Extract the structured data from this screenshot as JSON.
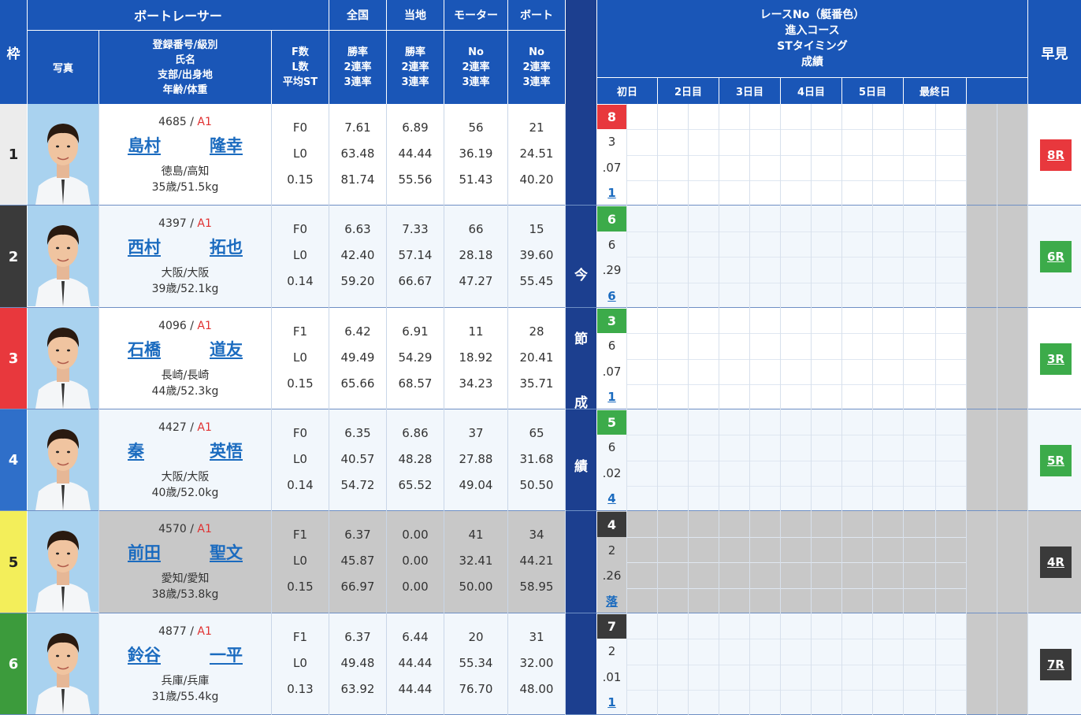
{
  "header": {
    "boatracer": "ボートレーサー",
    "zenkoku": "全国",
    "touchi": "当地",
    "motor": "モーター",
    "boat": "ボート",
    "waku": "枠",
    "photo": "写真",
    "profile": [
      "登録番号/級別",
      "氏名",
      "支部/出身地",
      "年齢/体重"
    ],
    "fl": [
      "F数",
      "L数",
      "平均ST"
    ],
    "zenkoku_sub": [
      "勝率",
      "2連率",
      "3連率"
    ],
    "touchi_sub": [
      "勝率",
      "2連率",
      "3連率"
    ],
    "motor_sub": [
      "No",
      "2連率",
      "3連率"
    ],
    "boat_sub": [
      "No",
      "2連率",
      "3連率"
    ],
    "konsetsu": [
      "今",
      "節",
      "成",
      "績"
    ],
    "race_info": [
      "レースNo（艇番色）",
      "進入コース",
      "STタイミング",
      "成績"
    ],
    "days": [
      "初日",
      "2日目",
      "3日目",
      "4日目",
      "5日目",
      "最終日"
    ],
    "hayami": "早見"
  },
  "colors": {
    "header_blue": "#1a56b7",
    "header_dark": "#1c3f8f",
    "link_blue": "#1b6bbf",
    "class_red": "#e03030",
    "lane1": "#ececec",
    "lane2": "#3a3a3a",
    "lane3": "#e8383d",
    "lane4": "#2f6fc9",
    "lane5": "#f3ee5a",
    "lane6": "#3c9b3c"
  },
  "racers": [
    {
      "lane": "1",
      "reg": "4685 /",
      "cls": "A1",
      "sei": "島村",
      "mei": "隆幸",
      "branch": "徳島/高知",
      "age_weight": "35歳/51.5kg",
      "f": "F0",
      "l": "L0",
      "st": "0.15",
      "z1": "7.61",
      "z2": "63.48",
      "z3": "81.74",
      "t1": "6.89",
      "t2": "44.44",
      "t3": "55.56",
      "m1": "56",
      "m2": "36.19",
      "m3": "51.43",
      "b1": "21",
      "b2": "24.51",
      "b3": "40.20",
      "race_boat": "8",
      "course": "3",
      "timing": ".07",
      "result": "1",
      "hayami": "8R",
      "boat_color": "#e8383d",
      "badge_color": "#e8383d",
      "shaded": false
    },
    {
      "lane": "2",
      "reg": "4397 /",
      "cls": "A1",
      "sei": "西村",
      "mei": "拓也",
      "branch": "大阪/大阪",
      "age_weight": "39歳/52.1kg",
      "f": "F0",
      "l": "L0",
      "st": "0.14",
      "z1": "6.63",
      "z2": "42.40",
      "z3": "59.20",
      "t1": "7.33",
      "t2": "57.14",
      "t3": "66.67",
      "m1": "66",
      "m2": "28.18",
      "m3": "47.27",
      "b1": "15",
      "b2": "39.60",
      "b3": "55.45",
      "race_boat": "6",
      "course": "6",
      "timing": ".29",
      "result": "6",
      "hayami": "6R",
      "boat_color": "#3cab4a",
      "badge_color": "#3cab4a",
      "shaded": false
    },
    {
      "lane": "3",
      "reg": "4096 /",
      "cls": "A1",
      "sei": "石橋",
      "mei": "道友",
      "branch": "長崎/長崎",
      "age_weight": "44歳/52.3kg",
      "f": "F1",
      "l": "L0",
      "st": "0.15",
      "z1": "6.42",
      "z2": "49.49",
      "z3": "65.66",
      "t1": "6.91",
      "t2": "54.29",
      "t3": "68.57",
      "m1": "11",
      "m2": "18.92",
      "m3": "34.23",
      "b1": "28",
      "b2": "20.41",
      "b3": "35.71",
      "race_boat": "3",
      "course": "6",
      "timing": ".07",
      "result": "1",
      "hayami": "3R",
      "boat_color": "#3cab4a",
      "badge_color": "#3cab4a",
      "shaded": false
    },
    {
      "lane": "4",
      "reg": "4427 /",
      "cls": "A1",
      "sei": "秦",
      "mei": "英悟",
      "branch": "大阪/大阪",
      "age_weight": "40歳/52.0kg",
      "f": "F0",
      "l": "L0",
      "st": "0.14",
      "z1": "6.35",
      "z2": "40.57",
      "z3": "54.72",
      "t1": "6.86",
      "t2": "48.28",
      "t3": "65.52",
      "m1": "37",
      "m2": "27.88",
      "m3": "49.04",
      "b1": "65",
      "b2": "31.68",
      "b3": "50.50",
      "race_boat": "5",
      "course": "6",
      "timing": ".02",
      "result": "4",
      "hayami": "5R",
      "boat_color": "#3cab4a",
      "badge_color": "#3cab4a",
      "shaded": false
    },
    {
      "lane": "5",
      "reg": "4570 /",
      "cls": "A1",
      "sei": "前田",
      "mei": "聖文",
      "branch": "愛知/愛知",
      "age_weight": "38歳/53.8kg",
      "f": "F1",
      "l": "L0",
      "st": "0.15",
      "z1": "6.37",
      "z2": "45.87",
      "z3": "66.97",
      "t1": "0.00",
      "t2": "0.00",
      "t3": "0.00",
      "m1": "41",
      "m2": "32.41",
      "m3": "50.00",
      "b1": "34",
      "b2": "44.21",
      "b3": "58.95",
      "race_boat": "4",
      "course": "2",
      "timing": ".26",
      "result": "落",
      "hayami": "4R",
      "boat_color": "#3a3a3a",
      "badge_color": "#3a3a3a",
      "shaded": true
    },
    {
      "lane": "6",
      "reg": "4877 /",
      "cls": "A1",
      "sei": "鈴谷",
      "mei": "一平",
      "branch": "兵庫/兵庫",
      "age_weight": "31歳/55.4kg",
      "f": "F1",
      "l": "L0",
      "st": "0.13",
      "z1": "6.37",
      "z2": "49.48",
      "z3": "63.92",
      "t1": "6.44",
      "t2": "44.44",
      "t3": "44.44",
      "m1": "20",
      "m2": "55.34",
      "m3": "76.70",
      "b1": "31",
      "b2": "32.00",
      "b3": "48.00",
      "race_boat": "7",
      "course": "2",
      "timing": ".01",
      "result": "1",
      "hayami": "7R",
      "boat_color": "#3a3a3a",
      "badge_color": "#3a3a3a",
      "shaded": false
    }
  ]
}
